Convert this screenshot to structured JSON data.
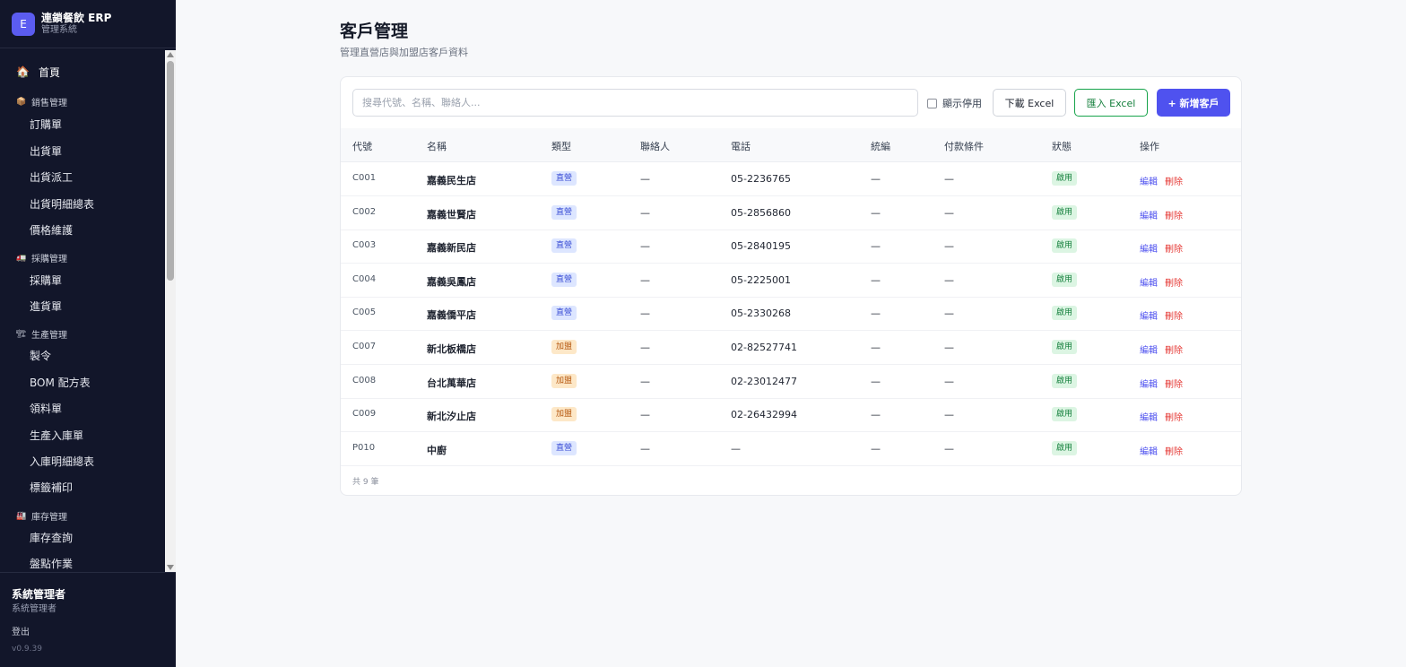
{
  "brand": {
    "logo_letter": "E",
    "title": "連鎖餐飲 ERP",
    "subtitle": "管理系統"
  },
  "sidebar": {
    "home": {
      "icon": "🏠",
      "label": "首頁"
    },
    "groups": [
      {
        "icon": "📦",
        "label": "銷售管理",
        "items": [
          "訂購單",
          "出貨單",
          "出貨派工",
          "出貨明細總表",
          "價格維護"
        ]
      },
      {
        "icon": "🚛",
        "label": "採購管理",
        "items": [
          "採購單",
          "進貨單"
        ]
      },
      {
        "icon": "🏗",
        "label": "生產管理",
        "items": [
          "製令",
          "BOM 配方表",
          "領料單",
          "生產入庫單",
          "入庫明細總表",
          "標籤補印"
        ]
      },
      {
        "icon": "🏭",
        "label": "庫存管理",
        "items": [
          "庫存查詢",
          "盤點作業"
        ]
      }
    ]
  },
  "user": {
    "name": "系統管理者",
    "role": "系統管理者",
    "logout": "登出",
    "version": "v0.9.39"
  },
  "page": {
    "title": "客戶管理",
    "subtitle": "管理直營店與加盟店客戶資料"
  },
  "toolbar": {
    "search_placeholder": "搜尋代號、名稱、聯絡人...",
    "show_disabled_label": "顯示停用",
    "download_label": "下載 Excel",
    "import_label": "匯入 Excel",
    "add_label": "+ 新增客戶"
  },
  "table": {
    "headers": [
      "代號",
      "名稱",
      "類型",
      "聯絡人",
      "電話",
      "統編",
      "付款條件",
      "狀態",
      "操作"
    ],
    "rows": [
      {
        "code": "C001",
        "name": "嘉義民生店",
        "type": "直營",
        "contact": "—",
        "phone": "05-2236765",
        "tax": "—",
        "payment": "—",
        "status": "啟用",
        "edit": "編輯",
        "delete": "刪除"
      },
      {
        "code": "C002",
        "name": "嘉義世賢店",
        "type": "直營",
        "contact": "—",
        "phone": "05-2856860",
        "tax": "—",
        "payment": "—",
        "status": "啟用",
        "edit": "編輯",
        "delete": "刪除"
      },
      {
        "code": "C003",
        "name": "嘉義新民店",
        "type": "直營",
        "contact": "—",
        "phone": "05-2840195",
        "tax": "—",
        "payment": "—",
        "status": "啟用",
        "edit": "編輯",
        "delete": "刪除"
      },
      {
        "code": "C004",
        "name": "嘉義吳鳳店",
        "type": "直營",
        "contact": "—",
        "phone": "05-2225001",
        "tax": "—",
        "payment": "—",
        "status": "啟用",
        "edit": "編輯",
        "delete": "刪除"
      },
      {
        "code": "C005",
        "name": "嘉義僑平店",
        "type": "直營",
        "contact": "—",
        "phone": "05-2330268",
        "tax": "—",
        "payment": "—",
        "status": "啟用",
        "edit": "編輯",
        "delete": "刪除"
      },
      {
        "code": "C007",
        "name": "新北板橋店",
        "type": "加盟",
        "contact": "—",
        "phone": "02-82527741",
        "tax": "—",
        "payment": "—",
        "status": "啟用",
        "edit": "編輯",
        "delete": "刪除"
      },
      {
        "code": "C008",
        "name": "台北萬華店",
        "type": "加盟",
        "contact": "—",
        "phone": "02-23012477",
        "tax": "—",
        "payment": "—",
        "status": "啟用",
        "edit": "編輯",
        "delete": "刪除"
      },
      {
        "code": "C009",
        "name": "新北汐止店",
        "type": "加盟",
        "contact": "—",
        "phone": "02-26432994",
        "tax": "—",
        "payment": "—",
        "status": "啟用",
        "edit": "編輯",
        "delete": "刪除"
      },
      {
        "code": "P010",
        "name": "中廚",
        "type": "直營",
        "contact": "—",
        "phone": "—",
        "tax": "—",
        "payment": "—",
        "status": "啟用",
        "edit": "編輯",
        "delete": "刪除"
      }
    ],
    "total_text": "共 9 筆"
  }
}
